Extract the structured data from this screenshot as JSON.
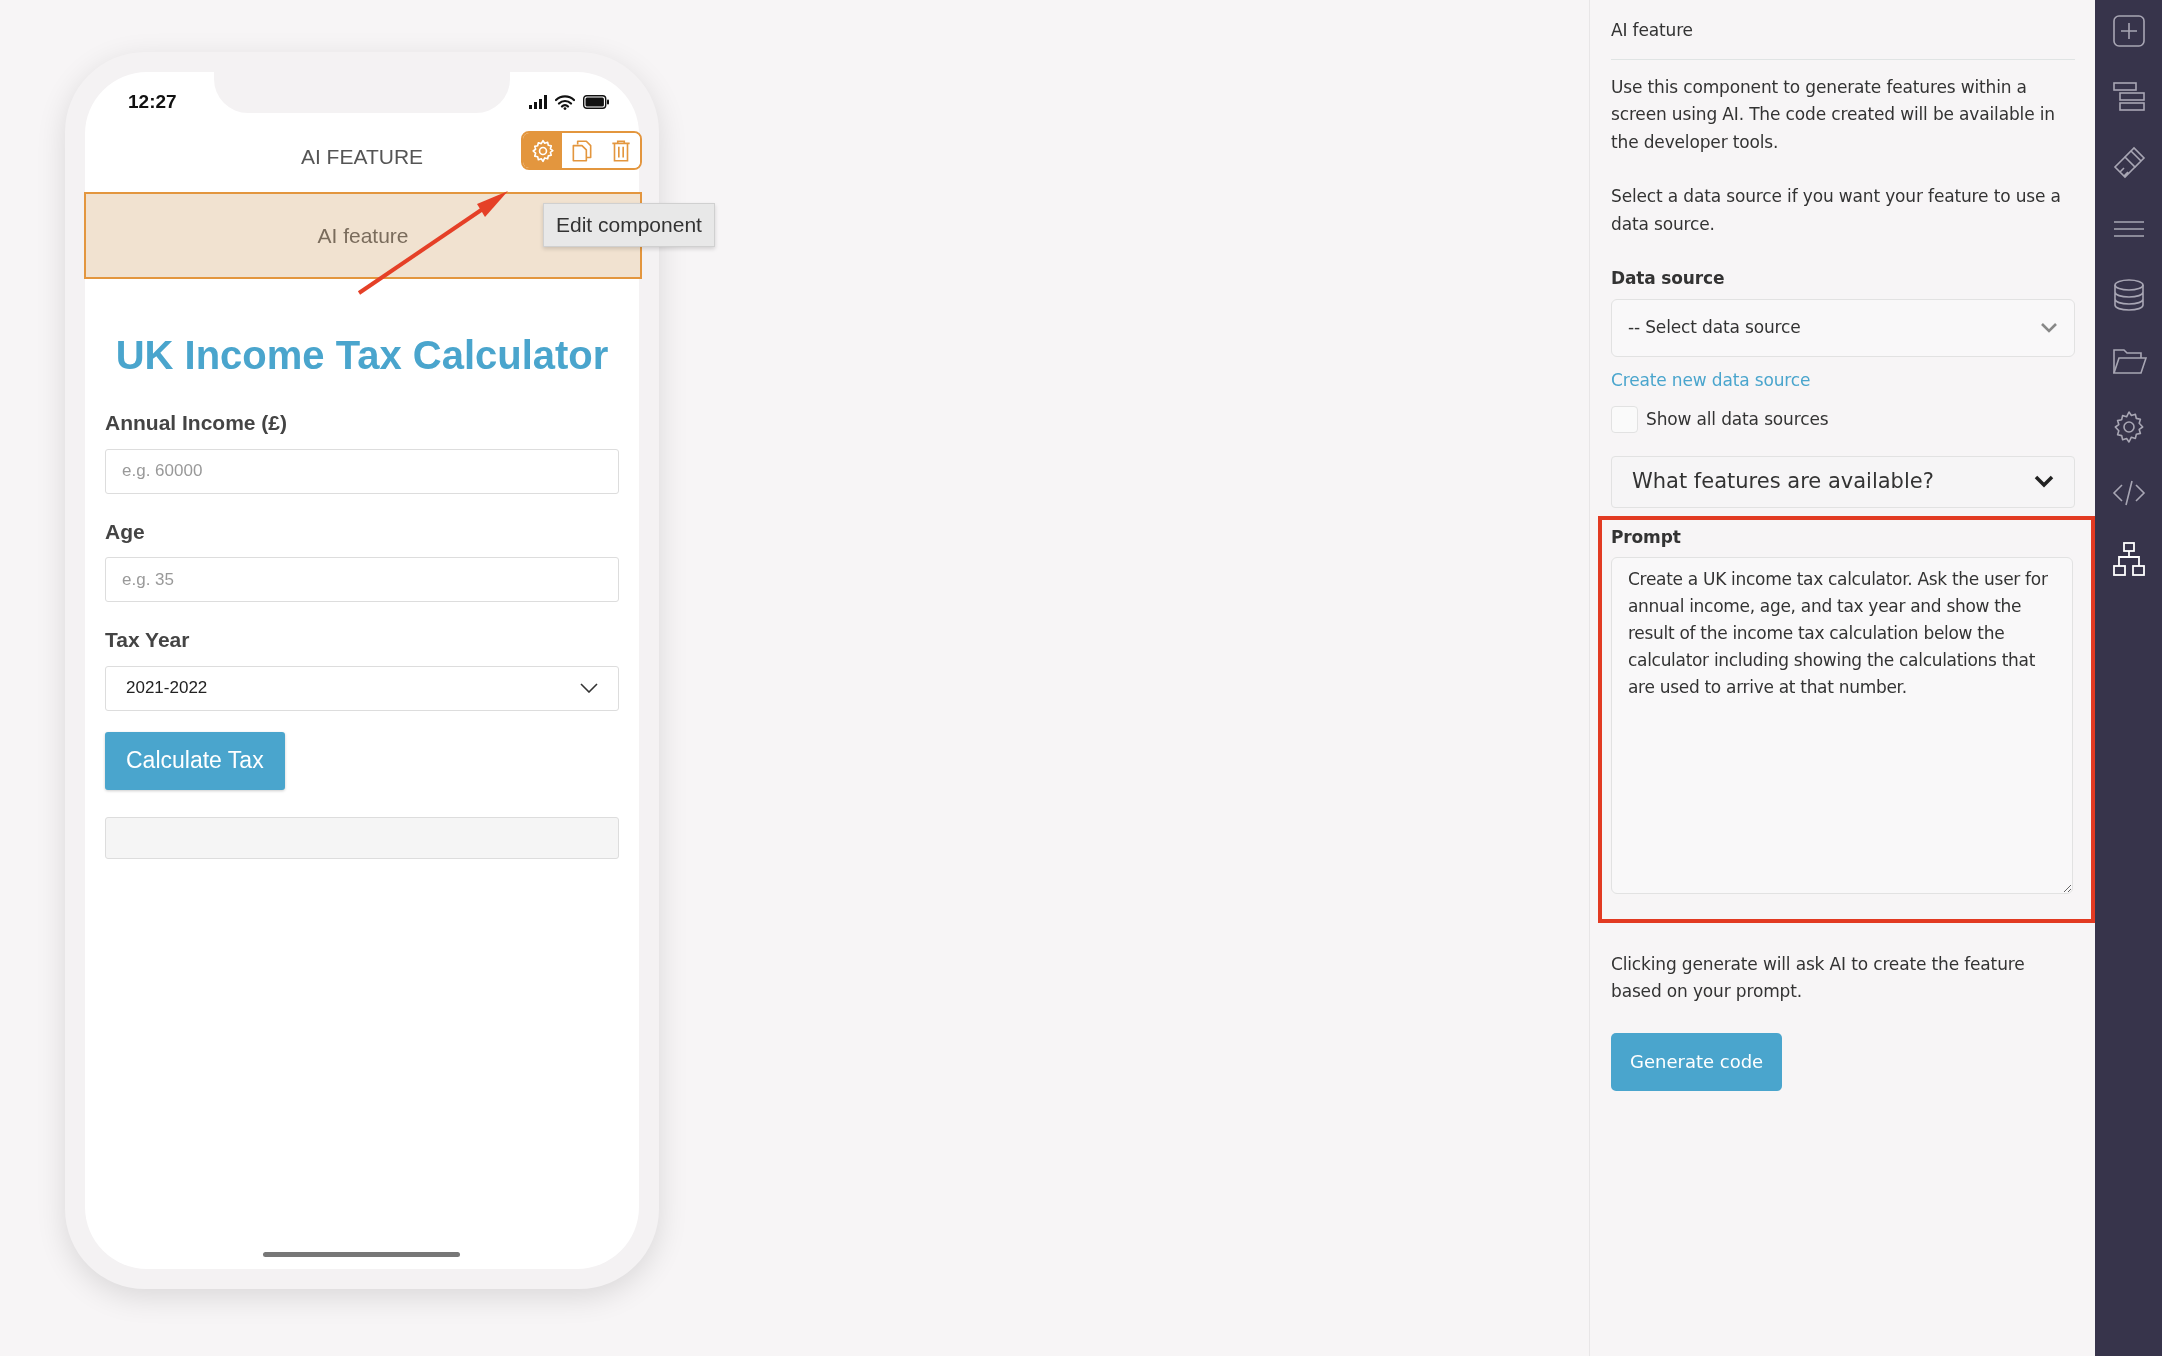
{
  "phone": {
    "status_time": "12:27",
    "header_title": "AI FEATURE",
    "component": {
      "label": "AI feature",
      "selected": true
    },
    "tools": [
      {
        "kind": "settings",
        "selected": true
      },
      {
        "kind": "copy",
        "selected": false
      },
      {
        "kind": "delete",
        "selected": false
      }
    ],
    "tooltip": "Edit component",
    "form": {
      "title": "UK Income Tax Calculator",
      "fields": [
        {
          "kind": "input",
          "label": "Annual Income (£)",
          "placeholder": "e.g. 60000"
        },
        {
          "kind": "input",
          "label": "Age",
          "placeholder": "e.g. 35"
        },
        {
          "kind": "select",
          "label": "Tax Year",
          "value": "2021-2022"
        }
      ],
      "button": "Calculate Tax"
    }
  },
  "panel": {
    "title": "AI feature",
    "paragraphs": [
      "Use this component to generate features within a screen using AI. The code created will be available in the developer tools.",
      "Select a data source if you want your feature to use a data source."
    ],
    "data_source": {
      "label": "Data source",
      "value": "-- Select data source"
    },
    "create_link": "Create new data source",
    "show_all": {
      "label": "Show all data sources",
      "checked": false
    },
    "accordion": {
      "label": "What features are available?",
      "expanded": false
    },
    "prompt": {
      "label": "Prompt",
      "value": "Create a UK income tax calculator. Ask the user for annual income, age, and tax year and show the result of the income tax calculation below the calculator including showing the calculations that are used to arrive at that number.",
      "highlighted": true
    },
    "note": "Clicking generate will ask AI to create the feature based on your prompt.",
    "button": "Generate code"
  },
  "sidebar": {
    "items": [
      {
        "kind": "add"
      },
      {
        "kind": "layers"
      },
      {
        "kind": "brush"
      },
      {
        "kind": "menu"
      },
      {
        "kind": "database"
      },
      {
        "kind": "folder"
      },
      {
        "kind": "settings"
      },
      {
        "kind": "code"
      },
      {
        "kind": "sitemap"
      }
    ]
  }
}
